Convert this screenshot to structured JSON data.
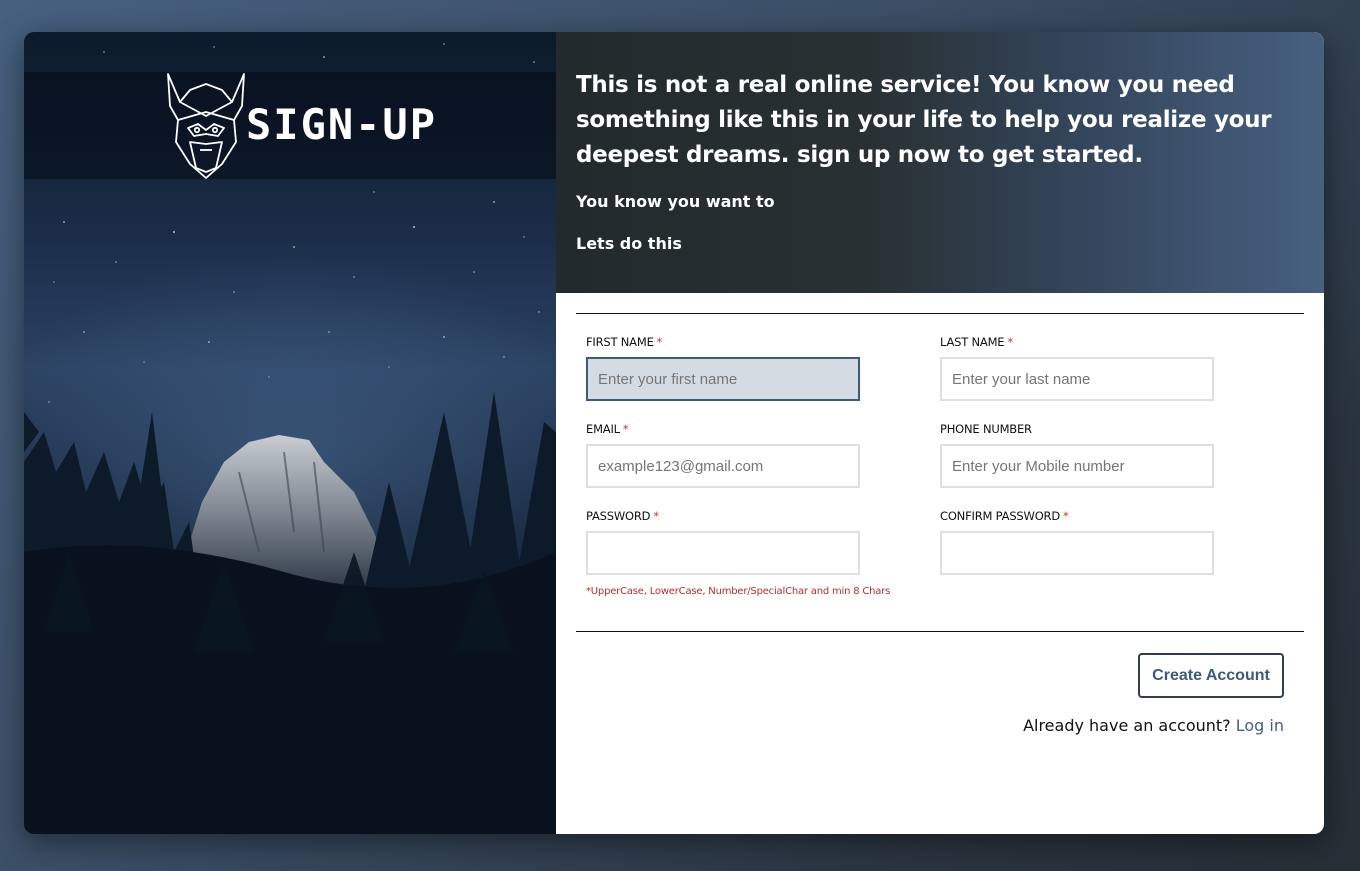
{
  "brand": {
    "title": "SIGN-UP",
    "logo_icon": "viking-helmet-icon"
  },
  "hero": {
    "headline": "This is not a real online service! You know you need something like this in your life to help you realize your deepest dreams. sign up now to get started.",
    "line1": "You know you want to",
    "line2": "Lets do this"
  },
  "form": {
    "required_mark": "*",
    "first_name": {
      "label": "FIRST NAME",
      "placeholder": "Enter your first name",
      "value": ""
    },
    "last_name": {
      "label": "LAST NAME",
      "placeholder": "Enter your last name",
      "value": ""
    },
    "email": {
      "label": "EMAIL",
      "placeholder": "example123@gmail.com",
      "value": ""
    },
    "phone": {
      "label": "PHONE NUMBER",
      "placeholder": "Enter your Mobile number",
      "value": ""
    },
    "password": {
      "label": "PASSWORD",
      "placeholder": "",
      "value": ""
    },
    "confirm_password": {
      "label": "CONFIRM PASSWORD",
      "placeholder": "",
      "value": ""
    },
    "password_hint": "*UpperCase, LowerCase, Number/SpecialChar and min 8 Chars",
    "submit_label": "Create Account",
    "login_prompt": "Already have an account?",
    "login_link": "Log in"
  },
  "colors": {
    "accent": "#46607f",
    "required": "#c0392b",
    "hint": "#b03030"
  }
}
